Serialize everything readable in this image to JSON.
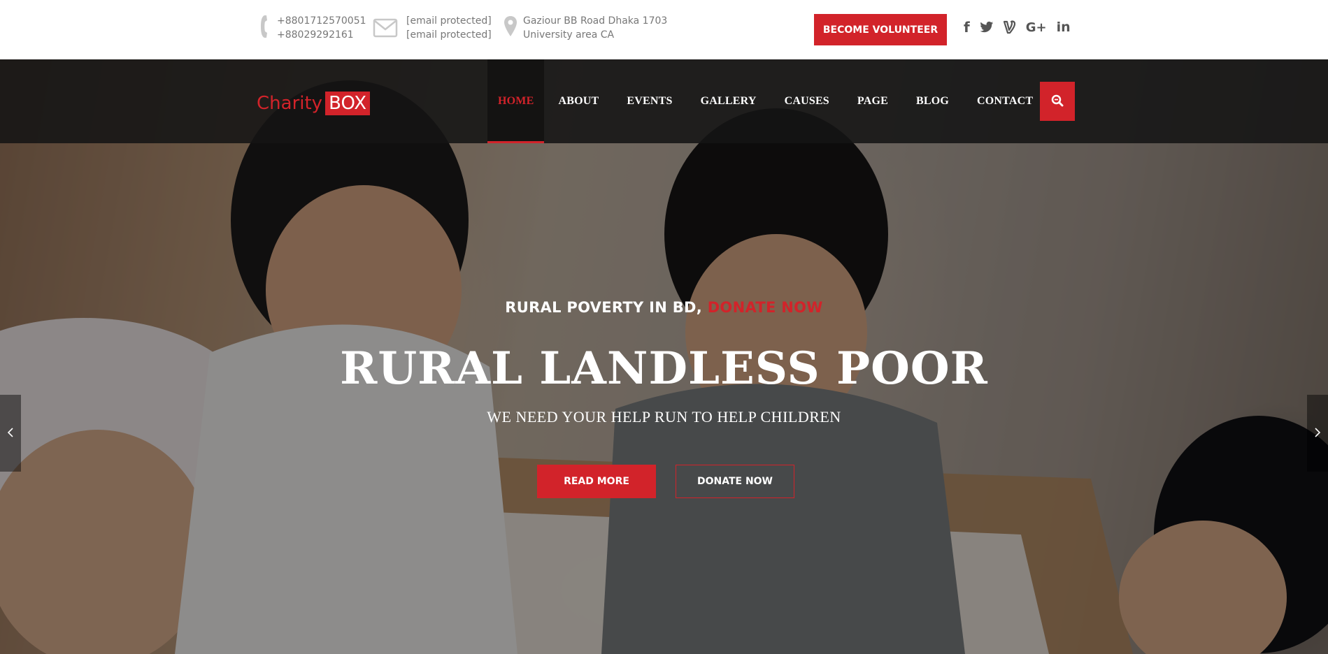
{
  "topbar": {
    "phone": {
      "line1": "+8801712570051",
      "line2": "+88029292161",
      "icon": "phone-icon"
    },
    "email": {
      "line1": "[email protected]",
      "line2": "[email protected]",
      "icon": "envelope-icon"
    },
    "address": {
      "line1": "Gaziour BB Road Dhaka 1703",
      "line2": "University area CA",
      "icon": "map-pin-icon"
    },
    "volunteer_label": "BECOME VOLUNTEER",
    "social": [
      {
        "name": "facebook",
        "glyph": "f"
      },
      {
        "name": "twitter",
        "glyph": "twitter"
      },
      {
        "name": "vine",
        "glyph": "V"
      },
      {
        "name": "google-plus",
        "glyph": "G+"
      },
      {
        "name": "linkedin",
        "glyph": "in"
      }
    ]
  },
  "logo": {
    "part1": "Charity",
    "part2": "BOX"
  },
  "nav": {
    "items": [
      "HOME",
      "ABOUT",
      "EVENTS",
      "GALLERY",
      "CAUSES",
      "PAGE",
      "BLOG",
      "CONTACT"
    ],
    "active": "HOME"
  },
  "hero": {
    "pre_title": "RURAL POVERTY IN BD,",
    "pre_title_accent": "DONATE NOW",
    "title": "RURAL LANDLESS POOR",
    "subtitle": "WE NEED YOUR HELP RUN TO HELP CHILDREN",
    "read_more_label": "READ MORE",
    "donate_label": "DONATE NOW"
  },
  "colors": {
    "accent": "#d2232a",
    "nav_bg": "#141414",
    "text_muted": "#777777"
  }
}
